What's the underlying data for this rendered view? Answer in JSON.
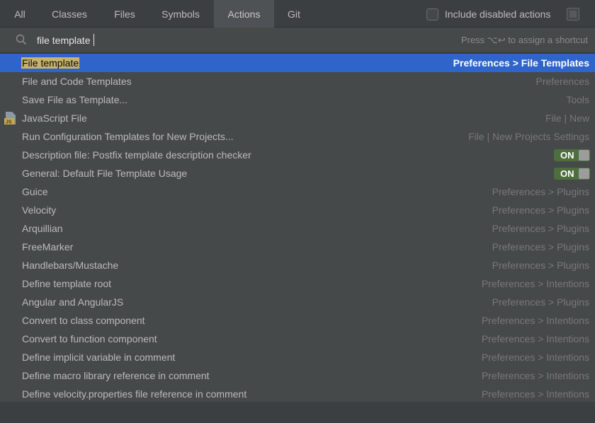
{
  "tabs": [
    {
      "label": "All"
    },
    {
      "label": "Classes"
    },
    {
      "label": "Files"
    },
    {
      "label": "Symbols"
    },
    {
      "label": "Actions",
      "active": true
    },
    {
      "label": "Git"
    }
  ],
  "include_disabled": {
    "label": "Include disabled actions",
    "checked": false
  },
  "search": {
    "value": "file template",
    "shortcut_hint": "Press ⌥↩ to assign a shortcut"
  },
  "results": [
    {
      "label": "File template",
      "location": "Preferences > File Templates",
      "selected": true
    },
    {
      "label": "File and Code Templates",
      "location": "Preferences"
    },
    {
      "label": "Save File as Template...",
      "location": "Tools"
    },
    {
      "label": "JavaScript File",
      "location": "File | New",
      "icon": "javascript-file-icon"
    },
    {
      "label": "Run Configuration Templates for New Projects...",
      "location": "File | New Projects Settings"
    },
    {
      "label": "Description file: Postfix template description checker",
      "toggle": "ON"
    },
    {
      "label": "General: Default File Template Usage",
      "toggle": "ON"
    },
    {
      "label": "Guice",
      "location": "Preferences > Plugins"
    },
    {
      "label": "Velocity",
      "location": "Preferences > Plugins"
    },
    {
      "label": "Arquillian",
      "location": "Preferences > Plugins"
    },
    {
      "label": "FreeMarker",
      "location": "Preferences > Plugins"
    },
    {
      "label": "Handlebars/Mustache",
      "location": "Preferences > Plugins"
    },
    {
      "label": "Define template root",
      "location": "Preferences > Intentions"
    },
    {
      "label": "Angular and AngularJS",
      "location": "Preferences > Plugins"
    },
    {
      "label": "Convert to class component",
      "location": "Preferences > Intentions"
    },
    {
      "label": "Convert to function component",
      "location": "Preferences > Intentions"
    },
    {
      "label": "Define implicit variable in comment",
      "location": "Preferences > Intentions"
    },
    {
      "label": "Define macro library reference in comment",
      "location": "Preferences > Intentions"
    },
    {
      "label": "Define velocity.properties file reference in comment",
      "location": "Preferences > Intentions"
    }
  ],
  "colors": {
    "selection": "#2f65ca",
    "match_highlight": "#c7b36b",
    "toggle_on": "#4d6e3d"
  }
}
